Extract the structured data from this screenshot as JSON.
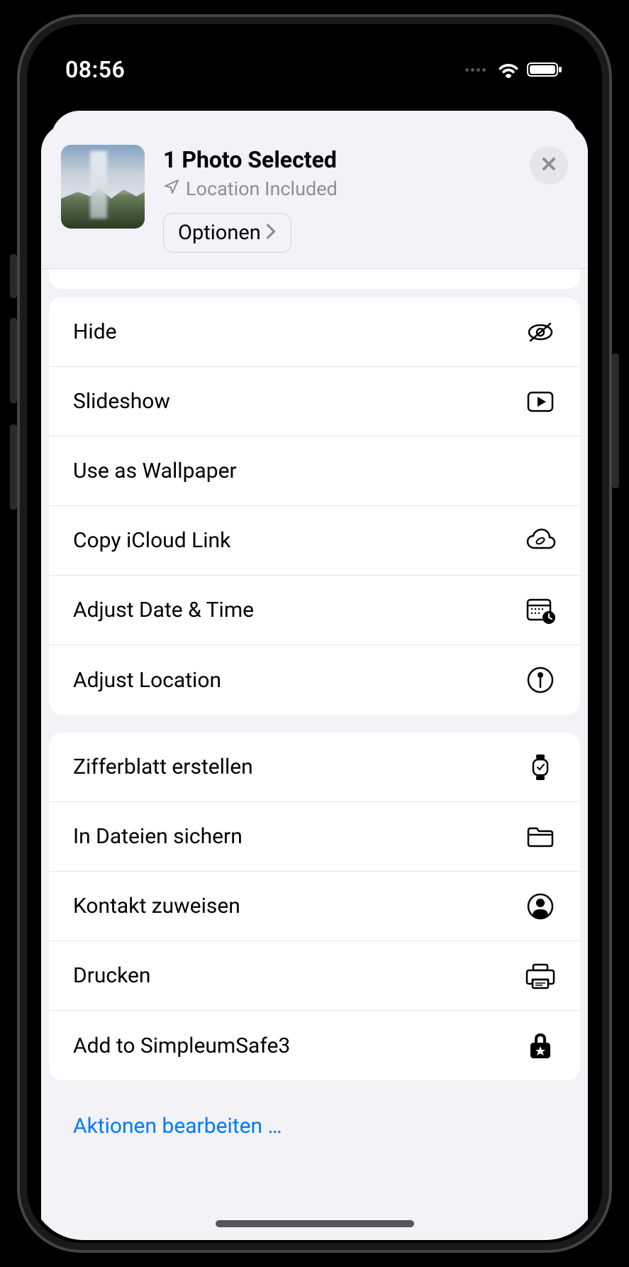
{
  "status_bar": {
    "time": "08:56"
  },
  "header": {
    "title": "1 Photo Selected",
    "location_text": "Location Included",
    "options_button": "Optionen"
  },
  "actions_group1": [
    {
      "label": "Hide",
      "icon": "eye-slash-icon"
    },
    {
      "label": "Slideshow",
      "icon": "play-rect-icon"
    },
    {
      "label": "Use as Wallpaper",
      "icon": ""
    },
    {
      "label": "Copy iCloud Link",
      "icon": "cloud-link-icon"
    },
    {
      "label": "Adjust Date & Time",
      "icon": "calendar-clock-icon"
    },
    {
      "label": "Adjust Location",
      "icon": "pin-circle-icon"
    }
  ],
  "actions_group2": [
    {
      "label": "Zifferblatt erstellen",
      "icon": "watch-icon"
    },
    {
      "label": "In Dateien sichern",
      "icon": "folder-icon"
    },
    {
      "label": "Kontakt zuweisen",
      "icon": "person-circle-icon"
    },
    {
      "label": "Drucken",
      "icon": "printer-icon"
    },
    {
      "label": "Add to SimpleumSafe3",
      "icon": "lock-star-icon"
    }
  ],
  "edit_actions": "Aktionen bearbeiten …"
}
